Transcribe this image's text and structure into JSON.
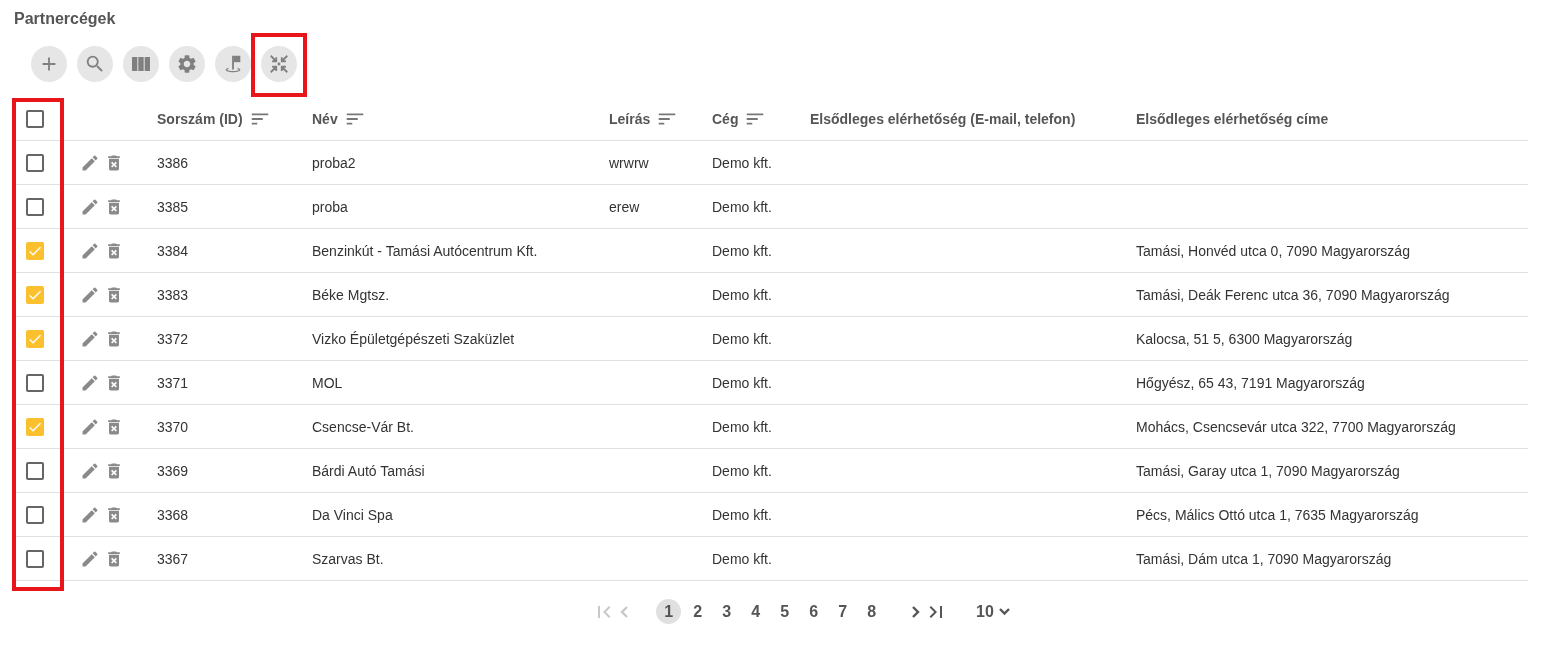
{
  "title": "Partnercégek",
  "toolbar": [
    {
      "kind": "add",
      "highlighted": false
    },
    {
      "kind": "search",
      "highlighted": false
    },
    {
      "kind": "columns",
      "highlighted": false
    },
    {
      "kind": "settings",
      "highlighted": false
    },
    {
      "kind": "flag",
      "highlighted": false
    },
    {
      "kind": "collapse",
      "highlighted": true
    }
  ],
  "table": {
    "select_column_highlighted": true,
    "all_checked": false,
    "columns": [
      {
        "label": "Sorszám (ID)",
        "sortable": true
      },
      {
        "label": "Név",
        "sortable": true
      },
      {
        "label": "Leírás",
        "sortable": true
      },
      {
        "label": "Cég",
        "sortable": true
      },
      {
        "label": "Elsődleges elérhetőség (E-mail, telefon)",
        "sortable": false
      },
      {
        "label": "Elsődleges elérhetőség címe",
        "sortable": false
      }
    ],
    "rows": [
      {
        "checked": false,
        "cells": [
          "3386",
          "proba2",
          "wrwrw",
          "Demo kft.",
          "",
          ""
        ]
      },
      {
        "checked": false,
        "cells": [
          "3385",
          "proba",
          "erew",
          "Demo kft.",
          "",
          ""
        ]
      },
      {
        "checked": true,
        "cells": [
          "3384",
          "Benzinkút - Tamási Autócentrum Kft.",
          "",
          "Demo kft.",
          "",
          "Tamási, Honvéd utca 0, 7090 Magyarország"
        ]
      },
      {
        "checked": true,
        "cells": [
          "3383",
          "Béke Mgtsz.",
          "",
          "Demo kft.",
          "",
          "Tamási, Deák Ferenc utca 36, 7090 Magyarország"
        ]
      },
      {
        "checked": true,
        "cells": [
          "3372",
          "Vizko Épületgépészeti Szaküzlet",
          "",
          "Demo kft.",
          "",
          "Kalocsa, 51 5, 6300 Magyarország"
        ]
      },
      {
        "checked": false,
        "cells": [
          "3371",
          "MOL",
          "",
          "Demo kft.",
          "",
          "Hőgyész, 65 43, 7191 Magyarország"
        ]
      },
      {
        "checked": true,
        "cells": [
          "3370",
          "Csencse-Vár Bt.",
          "",
          "Demo kft.",
          "",
          "Mohács, Csencsevár utca 322, 7700 Magyarország"
        ]
      },
      {
        "checked": false,
        "cells": [
          "3369",
          "Bárdi Autó Tamási",
          "",
          "Demo kft.",
          "",
          "Tamási, Garay utca 1, 7090 Magyarország"
        ]
      },
      {
        "checked": false,
        "cells": [
          "3368",
          "Da Vinci Spa",
          "",
          "Demo kft.",
          "",
          "Pécs, Málics Ottó utca 1, 7635 Magyarország"
        ]
      },
      {
        "checked": false,
        "cells": [
          "3367",
          "Szarvas Bt.",
          "",
          "Demo kft.",
          "",
          "Tamási, Dám utca 1, 7090 Magyarország"
        ]
      }
    ]
  },
  "pagination": {
    "first_disabled": true,
    "prev_disabled": true,
    "pages": [
      {
        "label": "1",
        "selected": true
      },
      {
        "label": "2",
        "selected": false
      },
      {
        "label": "3",
        "selected": false
      },
      {
        "label": "4",
        "selected": false
      },
      {
        "label": "5",
        "selected": false
      },
      {
        "label": "6",
        "selected": false
      },
      {
        "label": "7",
        "selected": false
      },
      {
        "label": "8",
        "selected": false
      }
    ],
    "page_size": "10"
  }
}
